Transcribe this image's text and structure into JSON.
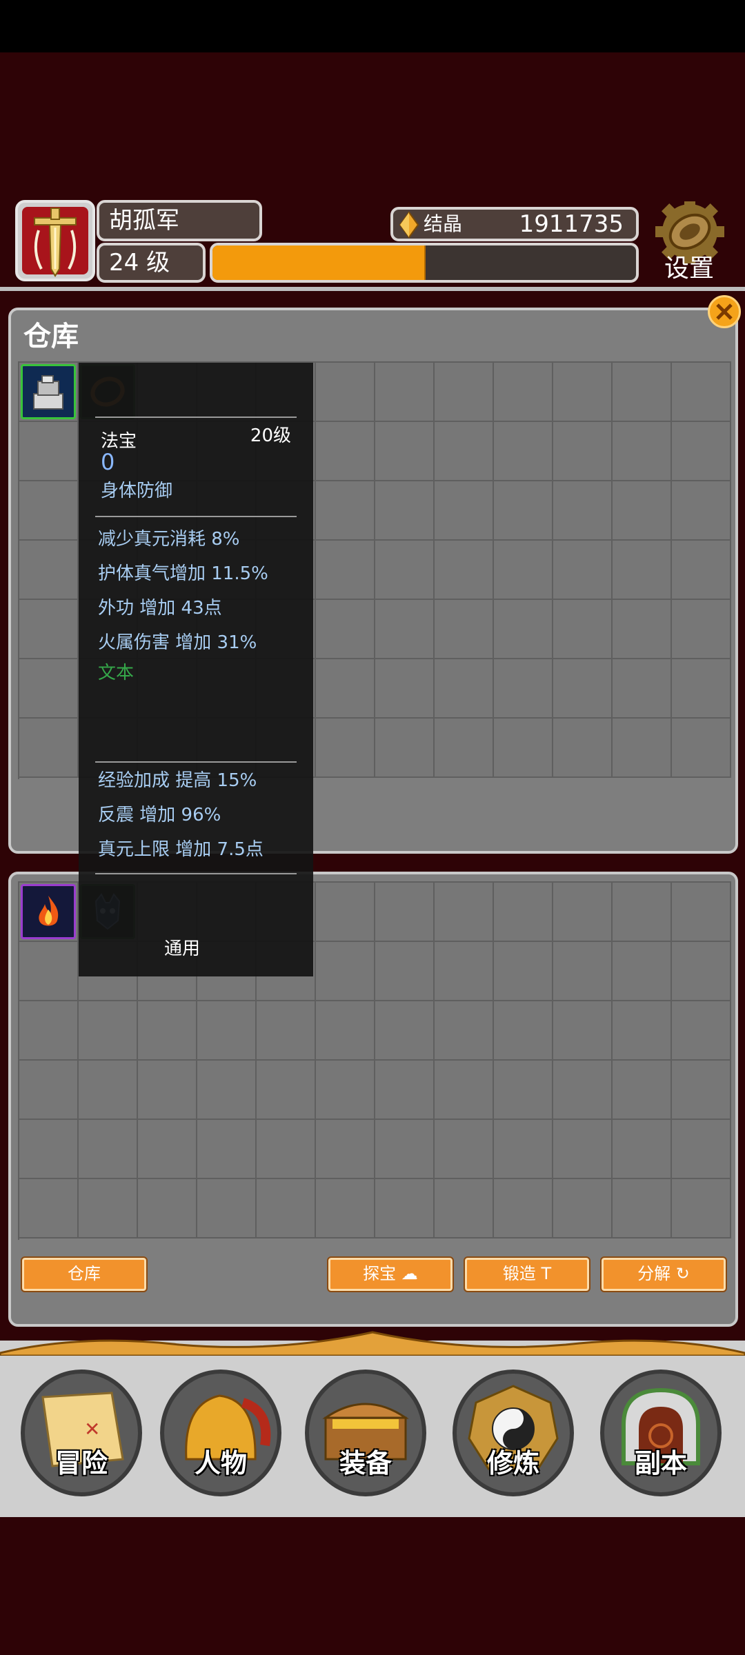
{
  "player": {
    "name": "胡孤军",
    "level": "24 级",
    "exp_fraction": 0.5
  },
  "currency": {
    "label": "结晶",
    "value": "1911735"
  },
  "settings": {
    "label": "设置"
  },
  "warehouse": {
    "title": "仓库"
  },
  "tooltip": {
    "type": "法宝",
    "level": "20级",
    "value": "0",
    "slot": "身体防御",
    "attrs_primary": [
      "减少真元消耗  8%",
      "护体真气增加  11.5%",
      "外功 增加 43点",
      "火属伤害 增加 31%"
    ],
    "custom_text": "文本",
    "attrs_secondary": [
      "经验加成 提高 15%",
      "反震 增加 96%",
      "真元上限 增加 7.5点"
    ],
    "general": "通用"
  },
  "buttons": {
    "warehouse": "仓库",
    "treasure": "探宝 ☁",
    "forge": "锻造 T",
    "decompose": "分解 ↻"
  },
  "nav": [
    {
      "label": "冒险",
      "icon": "treasure-map-icon"
    },
    {
      "label": "人物",
      "icon": "helmet-icon"
    },
    {
      "label": "装备",
      "icon": "treasure-chest-icon"
    },
    {
      "label": "修炼",
      "icon": "yin-yang-icon"
    },
    {
      "label": "副本",
      "icon": "cave-gate-icon"
    }
  ],
  "colors": {
    "background": "#2e0306",
    "exp_fill": "#f39a0c",
    "button": "#f2922c",
    "attr_text": "#a8cdf2",
    "custom_text": "#35a84a"
  }
}
